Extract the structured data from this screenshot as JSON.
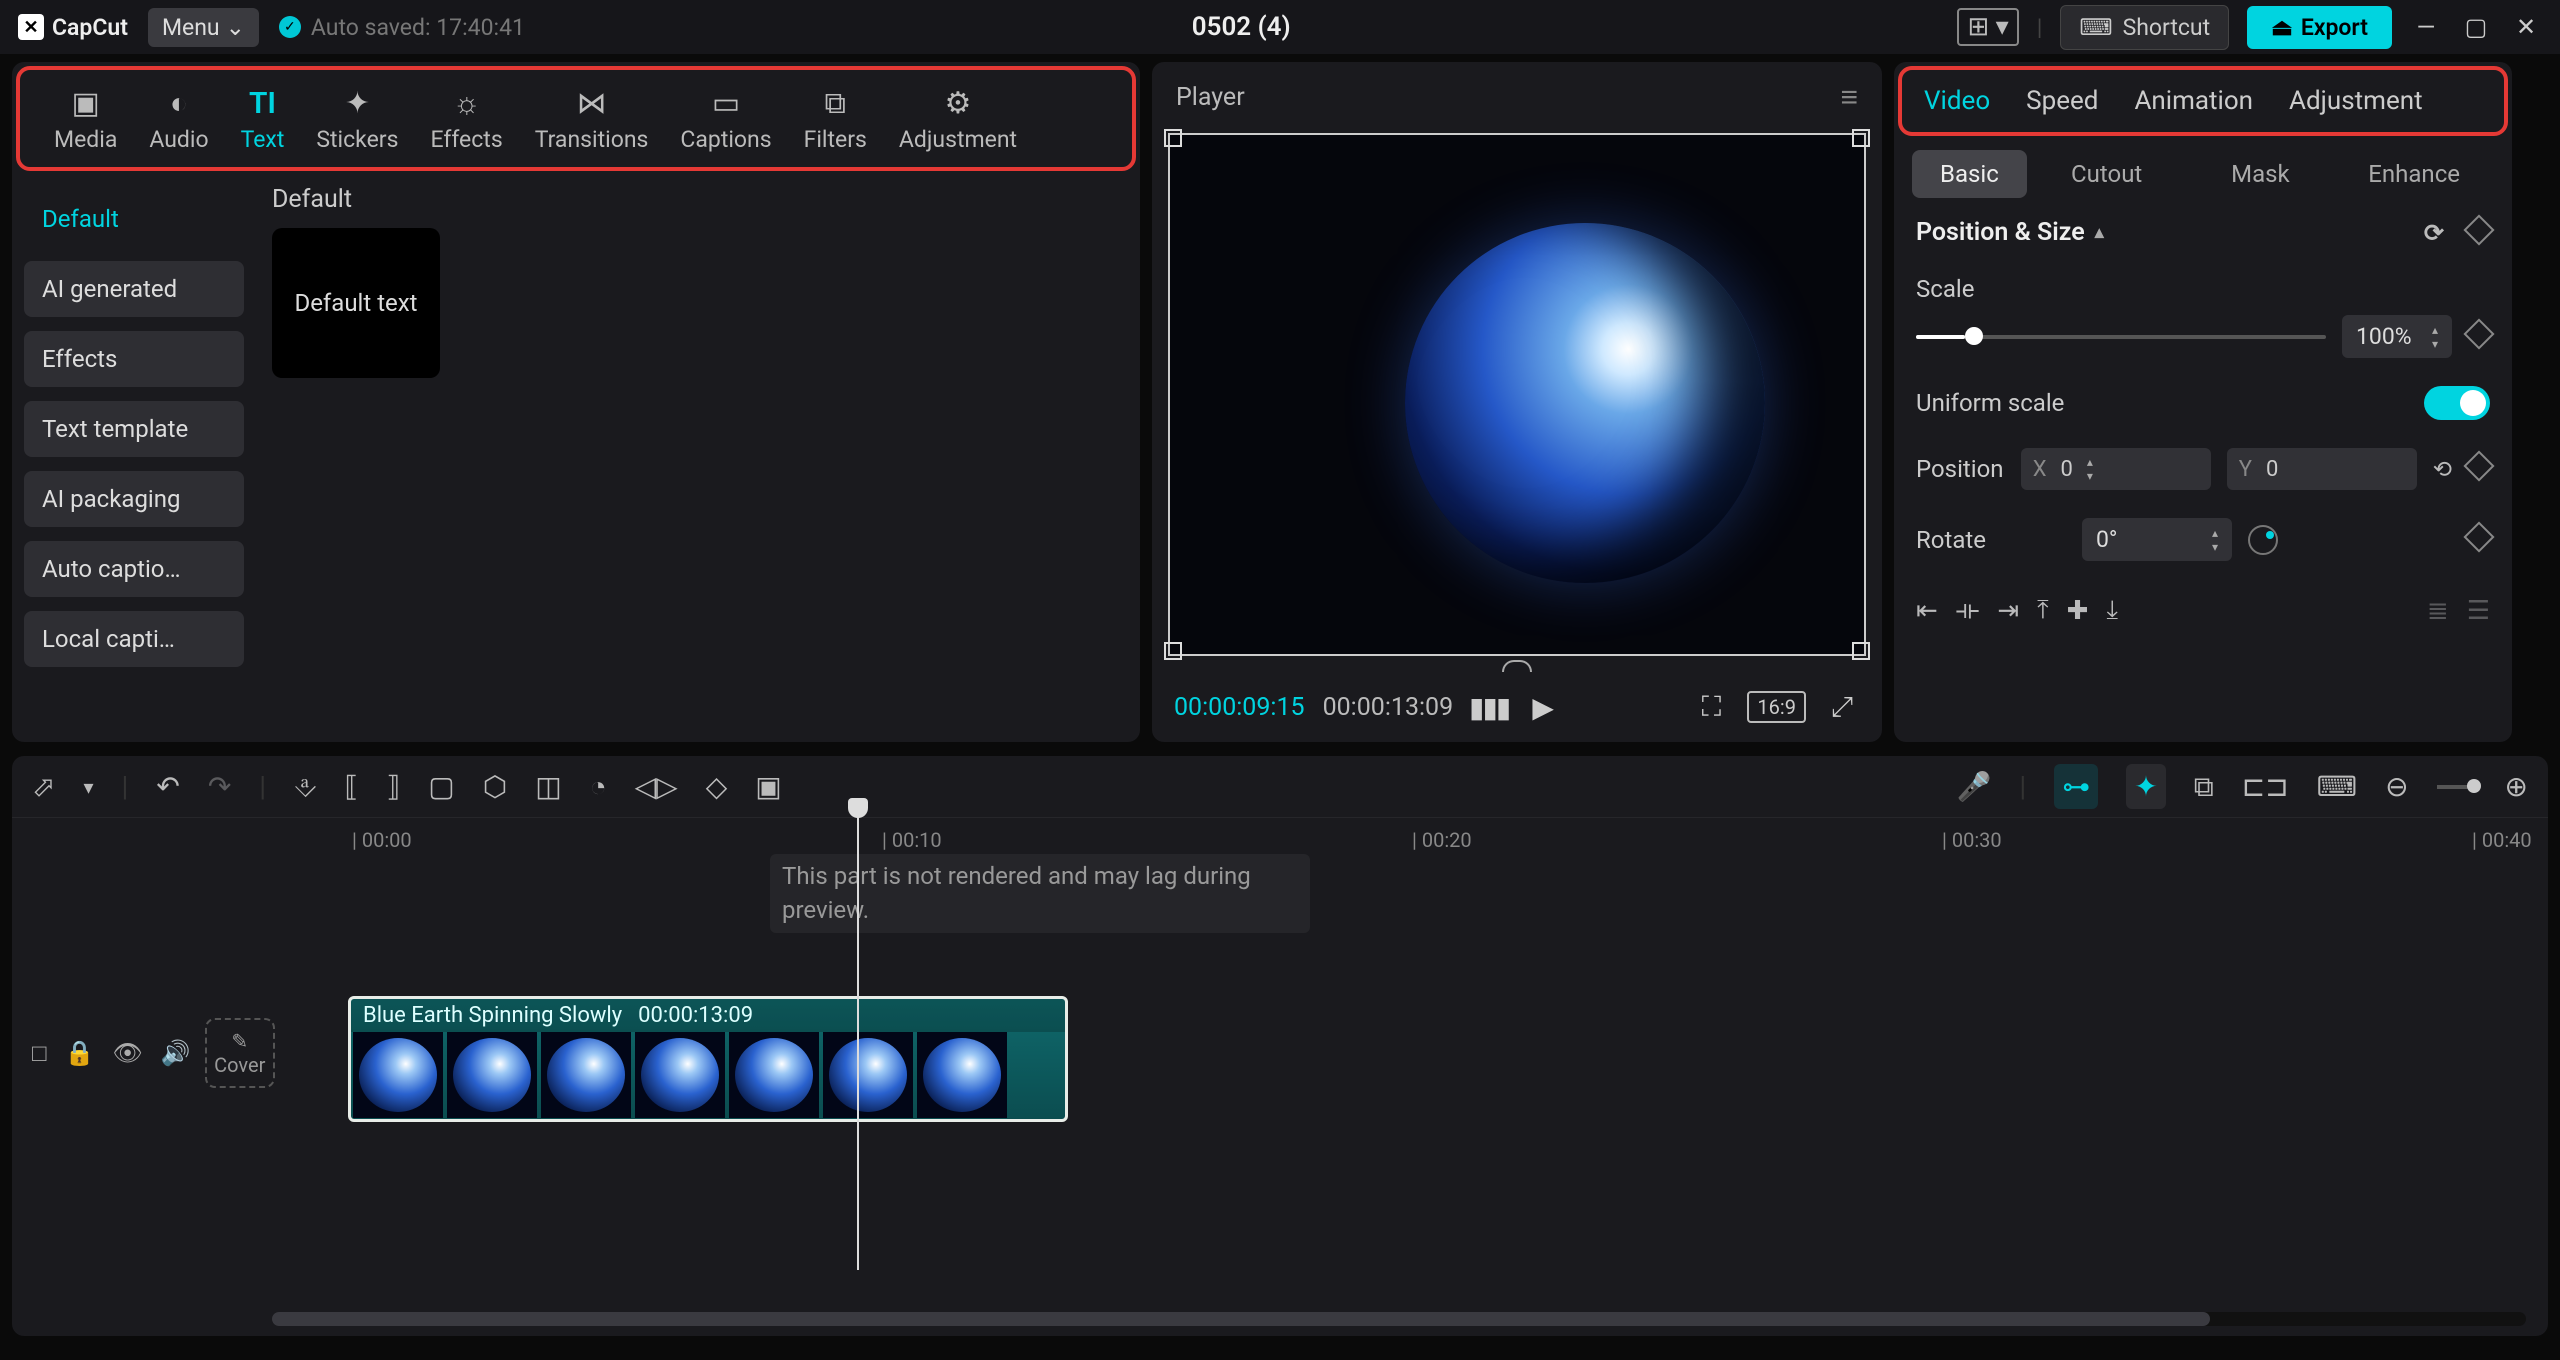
{
  "topbar": {
    "app_name": "CapCut",
    "menu_label": "Menu",
    "autosave": "Auto saved: 17:40:41",
    "project_name": "0502 (4)",
    "shortcut_label": "Shortcut",
    "export_label": "Export"
  },
  "tool_tabs": [
    {
      "label": "Media",
      "active": false
    },
    {
      "label": "Audio",
      "active": false
    },
    {
      "label": "Text",
      "active": true
    },
    {
      "label": "Stickers",
      "active": false
    },
    {
      "label": "Effects",
      "active": false
    },
    {
      "label": "Transitions",
      "active": false
    },
    {
      "label": "Captions",
      "active": false
    },
    {
      "label": "Filters",
      "active": false
    },
    {
      "label": "Adjustment",
      "active": false
    }
  ],
  "side_items": [
    {
      "label": "Default",
      "active": true
    },
    {
      "label": "AI generated",
      "active": false
    },
    {
      "label": "Effects",
      "active": false
    },
    {
      "label": "Text template",
      "active": false
    },
    {
      "label": "AI packaging",
      "active": false
    },
    {
      "label": "Auto captio…",
      "active": false
    },
    {
      "label": "Local capti…",
      "active": false
    }
  ],
  "asset": {
    "group_label": "Default",
    "thumb_label": "Default text"
  },
  "player": {
    "title": "Player",
    "current_time": "00:00:09:15",
    "duration": "00:00:13:09",
    "ratio": "16:9"
  },
  "prop_tabs": [
    {
      "label": "Video",
      "active": true
    },
    {
      "label": "Speed",
      "active": false
    },
    {
      "label": "Animation",
      "active": false
    },
    {
      "label": "Adjustment",
      "active": false
    }
  ],
  "sub_tabs": [
    {
      "label": "Basic",
      "active": true
    },
    {
      "label": "Cutout",
      "active": false
    },
    {
      "label": "Mask",
      "active": false
    },
    {
      "label": "Enhance",
      "active": false
    }
  ],
  "props": {
    "section": "Position & Size",
    "scale_label": "Scale",
    "scale_value": "100%",
    "uniform_label": "Uniform scale",
    "uniform_on": true,
    "position_label": "Position",
    "pos_x_label": "X",
    "pos_x": "0",
    "pos_y_label": "Y",
    "pos_y": "0",
    "rotate_label": "Rotate",
    "rotate_value": "0°"
  },
  "timeline": {
    "ticks": [
      "00:00",
      "00:10",
      "00:20",
      "00:30",
      "00:40"
    ],
    "hint": "This part is not rendered and may lag during preview.",
    "cover_label": "Cover",
    "clip": {
      "name": "Blue Earth Spinning Slowly",
      "duration": "00:00:13:09"
    }
  }
}
